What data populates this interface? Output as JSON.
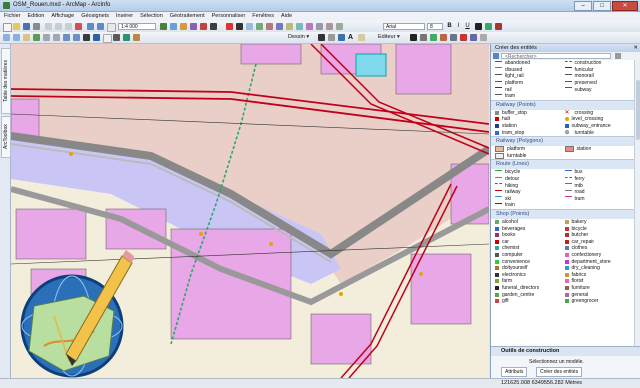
{
  "window": {
    "title": "OSM_Rouen.mxd - ArcMap - ArcInfo",
    "minimize": "–",
    "maximize": "□",
    "close": "✕"
  },
  "menu": [
    "Fichier",
    "Edition",
    "Affichage",
    "Géosignets",
    "Insérer",
    "Sélection",
    "Géotraitement",
    "Personnaliser",
    "Fenêtres",
    "Aide"
  ],
  "toolbar": {
    "scale": "1:4 000",
    "font": "Arial",
    "font_size": "8",
    "dessin": "Dessin ▾",
    "editeur": "Editeur ▾"
  },
  "left_tabs": [
    "Table des matières",
    "ArcToolbox"
  ],
  "panel": {
    "title": "Créer des entités",
    "search_placeholder": "<Rechercher>",
    "top_items": [
      [
        "abandoned",
        "construction"
      ],
      [
        "disused",
        "funicular"
      ],
      [
        "light_rail",
        "monorail"
      ],
      [
        "platform",
        "preserved"
      ],
      [
        "rail",
        "subway"
      ],
      [
        "tram",
        ""
      ]
    ],
    "groups": [
      {
        "title": "Railway (Points)",
        "items": [
          [
            "buffer_stop",
            "crossing"
          ],
          [
            "halt",
            "level_crossing"
          ],
          [
            "station",
            "subway_entrance"
          ],
          [
            "tram_stop",
            "turntable"
          ]
        ]
      },
      {
        "title": "Railway (Polygons)",
        "items": [
          [
            "platform",
            "station"
          ],
          [
            "turntable",
            ""
          ]
        ]
      },
      {
        "title": "Route (Lines)",
        "items": [
          [
            "bicycle",
            "bus"
          ],
          [
            "detour",
            "ferry"
          ],
          [
            "hiking",
            "mtb"
          ],
          [
            "railway",
            "road"
          ],
          [
            "ski",
            "tram"
          ],
          [
            "train",
            ""
          ]
        ]
      },
      {
        "title": "Shop (Points)",
        "items": [
          [
            "alcohol",
            "bakery"
          ],
          [
            "beverages",
            "bicycle"
          ],
          [
            "books",
            "butcher"
          ],
          [
            "car",
            "car_repair"
          ],
          [
            "chemist",
            "clothes"
          ],
          [
            "computer",
            "confectionery"
          ],
          [
            "convenience",
            "department_store"
          ],
          [
            "doityourself",
            "dry_cleaning"
          ],
          [
            "electronics",
            "fabrics"
          ],
          [
            "farm",
            "florist"
          ],
          [
            "funeral_directors",
            "furniture"
          ],
          [
            "garden_centre",
            "general"
          ],
          [
            "gift",
            "greengrocer"
          ]
        ]
      }
    ],
    "construction_title": "Outils de construction",
    "construction_msg": "Sélectionnez un modèle.",
    "attributes_btn": "Attributs",
    "create_btn": "Créer des entités"
  },
  "status": {
    "coordinates": "121625.008  6349556.282 Mètres"
  },
  "colors": {
    "accent": "#3f6fb5",
    "rail": "#c0001a",
    "building": "#e8a7e6",
    "water": "#c9c6f5",
    "landuse": "#e9cfc8"
  }
}
